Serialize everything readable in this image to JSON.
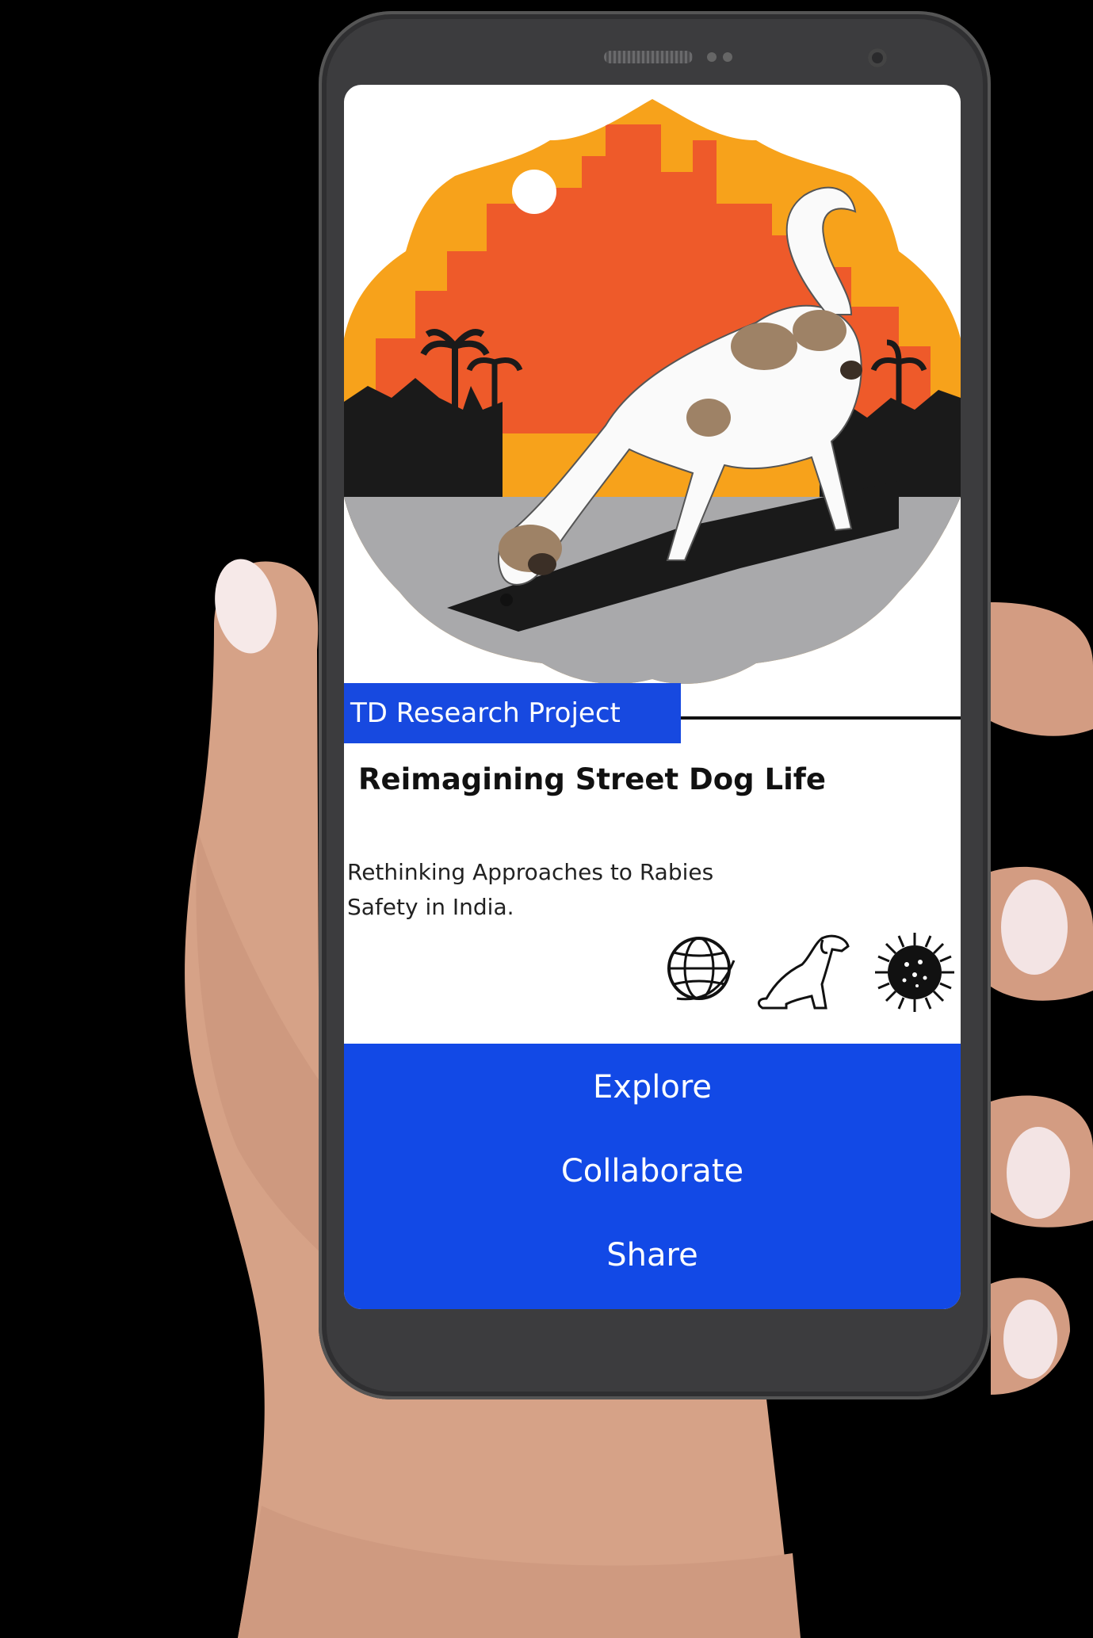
{
  "card": {
    "tag_label": "TD Research Project",
    "title": "Reimagining Street Dog Life",
    "description": "Rethinking Approaches to Rabies Safety in India."
  },
  "icons": [
    "globe-icon",
    "dog-icon",
    "virus-icon"
  ],
  "menu": {
    "items": [
      "Explore",
      "Collaborate",
      "Share"
    ]
  },
  "colors": {
    "accent": "#1249e6",
    "hero_orange": "#f7a21b",
    "hero_red": "#ee5a2a",
    "background": "#000000"
  }
}
